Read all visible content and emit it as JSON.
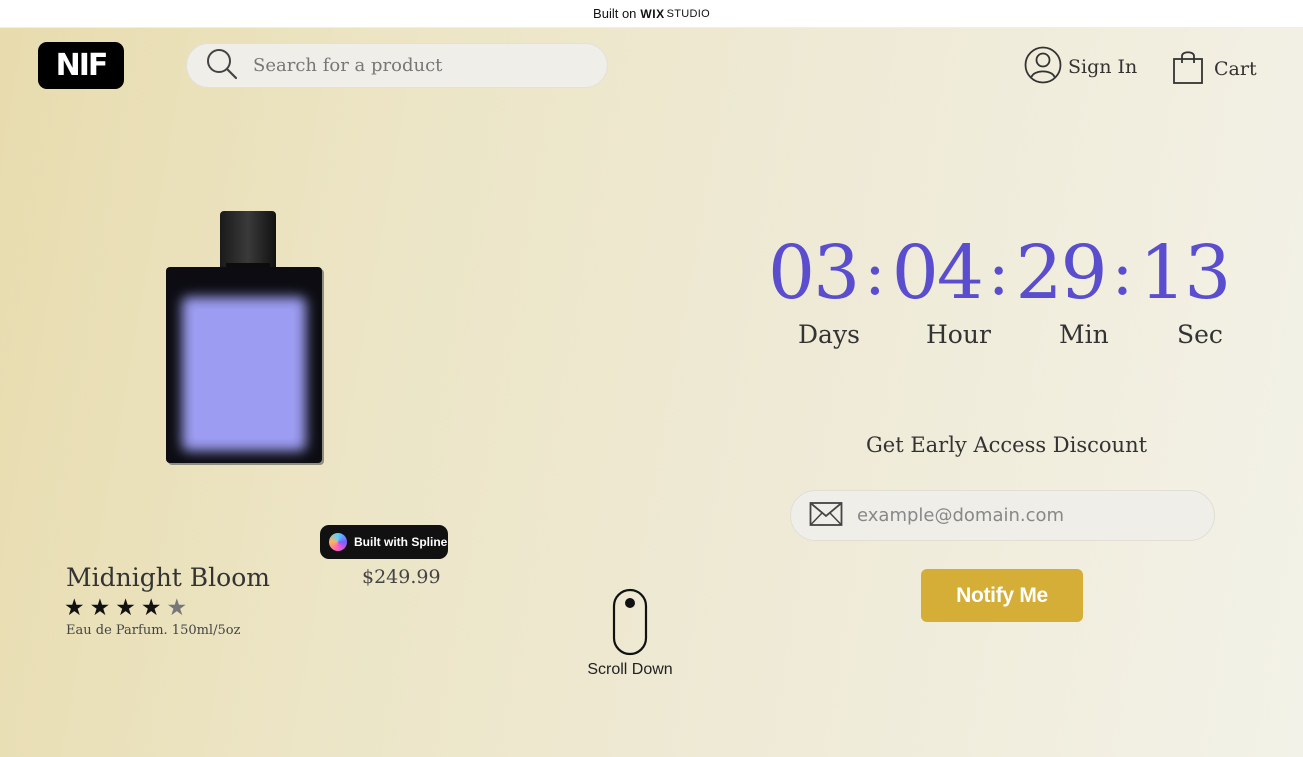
{
  "wix_bar": {
    "prefix": "Built on",
    "brand": "WIX",
    "product": "STUDIO"
  },
  "header": {
    "logo_text": "NIF",
    "search_placeholder": "Search for a product",
    "sign_in_label": "Sign In",
    "cart_label": "Cart"
  },
  "product": {
    "name": "Midnight Bloom",
    "price": "$249.99",
    "rating": 4,
    "rating_max": 5,
    "description": "Eau de Parfum. 150ml/5oz"
  },
  "spline_badge": {
    "label": "Built with Spline"
  },
  "scroll": {
    "label": "Scroll Down"
  },
  "countdown": {
    "days": "03",
    "hours": "04",
    "minutes": "29",
    "seconds": "13",
    "labels": {
      "days": "Days",
      "hours": "Hour",
      "minutes": "Min",
      "seconds": "Sec"
    }
  },
  "signup": {
    "title": "Get Early Access Discount",
    "email_placeholder": "example@domain.com",
    "button_label": "Notify Me"
  },
  "colors": {
    "accent": "#5a4ecf",
    "button": "#d4ae36",
    "bottle_label": "#9c9cf2"
  }
}
